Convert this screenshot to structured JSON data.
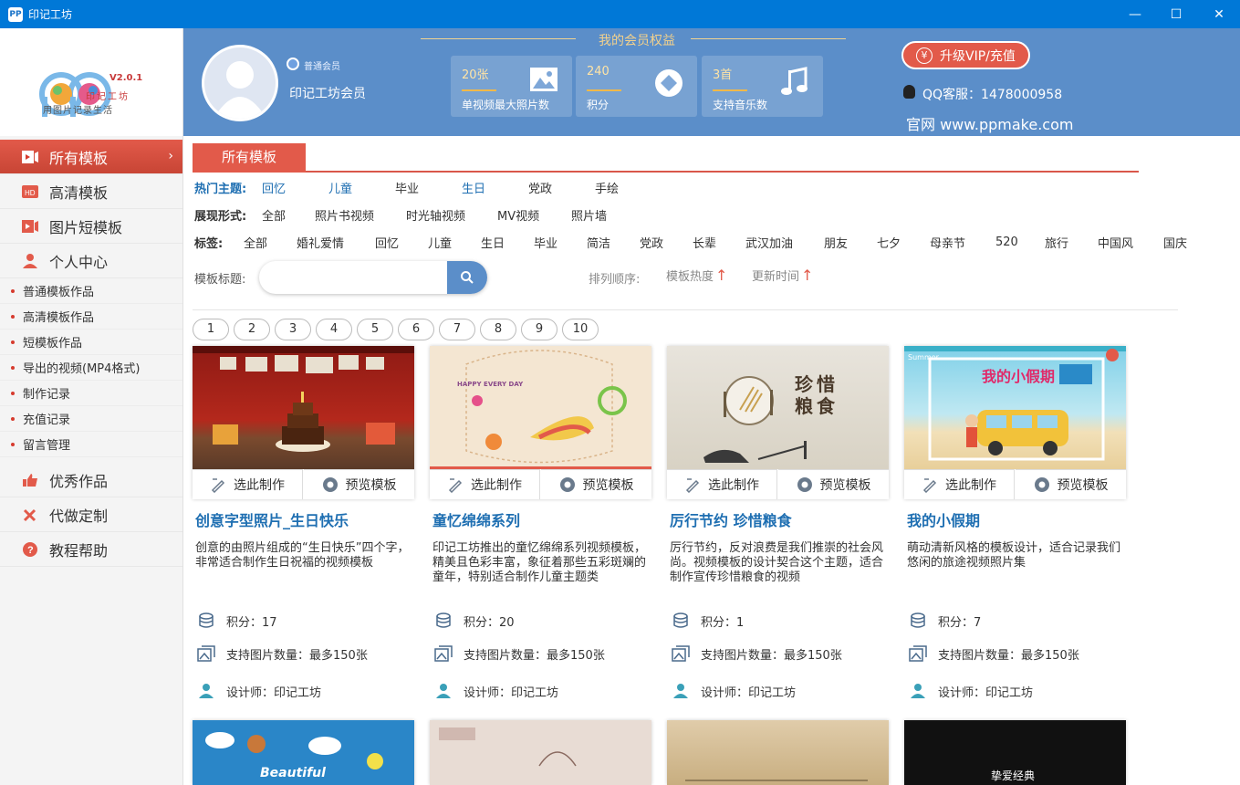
{
  "window": {
    "title": "印记工坊",
    "minimize": "—",
    "maximize": "☐",
    "close": "✕"
  },
  "logo": {
    "version": "V2.0.1",
    "brand": "印记工坊",
    "slogan": "用图片记录生活"
  },
  "sidebar": {
    "main_top": [
      {
        "label": "所有模板",
        "icon": "video-template-icon",
        "active": true
      },
      {
        "label": "高清模板",
        "icon": "hd-icon"
      },
      {
        "label": "图片短模板",
        "icon": "short-video-icon"
      },
      {
        "label": "个人中心",
        "icon": "user-icon"
      }
    ],
    "sub": [
      "普通模板作品",
      "高清模板作品",
      "短模板作品",
      "导出的视频(MP4格式)",
      "制作记录",
      "充值记录",
      "留言管理"
    ],
    "main_bottom": [
      {
        "label": "优秀作品",
        "icon": "thumbs-up-icon"
      },
      {
        "label": "代做定制",
        "icon": "tools-icon"
      },
      {
        "label": "教程帮助",
        "icon": "help-icon"
      }
    ]
  },
  "header": {
    "member_badge": "普通会员",
    "username": "印记工坊会员",
    "rights_title": "我的会员权益",
    "stats": [
      {
        "num": "20张",
        "label": "单视频最大照片数",
        "icon": "image-icon"
      },
      {
        "num": "240",
        "label": "积分",
        "icon": "diamond-icon"
      },
      {
        "num": "3首",
        "label": "支持音乐数",
        "icon": "music-icon"
      }
    ],
    "vip_button": "升级VIP/充值",
    "qq": "QQ客服：1478000958",
    "site": "官网 www.ppmake.com"
  },
  "main": {
    "tab": "所有模板",
    "hot": {
      "label": "热门主题:",
      "items": [
        "回忆",
        "儿童",
        "毕业",
        "生日",
        "党政",
        "手绘"
      ]
    },
    "form": {
      "label": "展现形式:",
      "items": [
        "全部",
        "照片书视频",
        "时光轴视频",
        "MV视频",
        "照片墙"
      ]
    },
    "tags": {
      "label": "标签:",
      "items": [
        "全部",
        "婚礼爱情",
        "回忆",
        "儿童",
        "生日",
        "毕业",
        "简洁",
        "党政",
        "长辈",
        "武汉加油",
        "朋友",
        "七夕",
        "母亲节",
        "520",
        "旅行",
        "中国风",
        "国庆"
      ]
    },
    "search": {
      "label": "模板标题:",
      "placeholder": ""
    },
    "sort": {
      "label": "排列顺序:",
      "hot": "模板热度",
      "time": "更新时间"
    },
    "pages": [
      "1",
      "2",
      "3",
      "4",
      "5",
      "6",
      "7",
      "8",
      "9",
      "10"
    ],
    "select_label": "选此制作",
    "preview_label": "预览模板",
    "cards": [
      {
        "title": "创意字型照片_生日快乐",
        "desc": "创意的由照片组成的“生日快乐”四个字，非常适合制作生日祝福的视频模板",
        "points": "积分：17",
        "photos": "支持图片数量：最多150张",
        "designer": "设计师：印记工坊"
      },
      {
        "title": "童忆绵绵系列",
        "desc": "印记工坊推出的童忆绵绵系列视频模板，精美且色彩丰富，象征着那些五彩斑斓的童年，特别适合制作儿童主题类",
        "points": "积分：20",
        "photos": "支持图片数量：最多150张",
        "designer": "设计师：印记工坊"
      },
      {
        "title": "厉行节约 珍惜粮食",
        "desc": "厉行节约，反对浪费是我们推崇的社会风尚。视频模板的设计契合这个主题，适合制作宣传珍惜粮食的视频",
        "points": "积分：1",
        "photos": "支持图片数量：最多150张",
        "designer": "设计师：印记工坊"
      },
      {
        "title": "我的小假期",
        "desc": "萌动清新风格的模板设计，适合记录我们悠闲的旅途视频照片集",
        "points": "积分：7",
        "photos": "支持图片数量：最多150张",
        "designer": "设计师：印记工坊"
      }
    ],
    "thumb_text": {
      "c1": "HAPPY EVERY DAY",
      "c2": "珍惜粮食",
      "c3": "我的小假期",
      "c3b": "Summer",
      "b0": "Beautiful",
      "b3": "挚爱经典"
    }
  },
  "colors": {
    "accent": "#e25a4a",
    "header": "#5b8ec9",
    "link": "#1f6fb2"
  }
}
